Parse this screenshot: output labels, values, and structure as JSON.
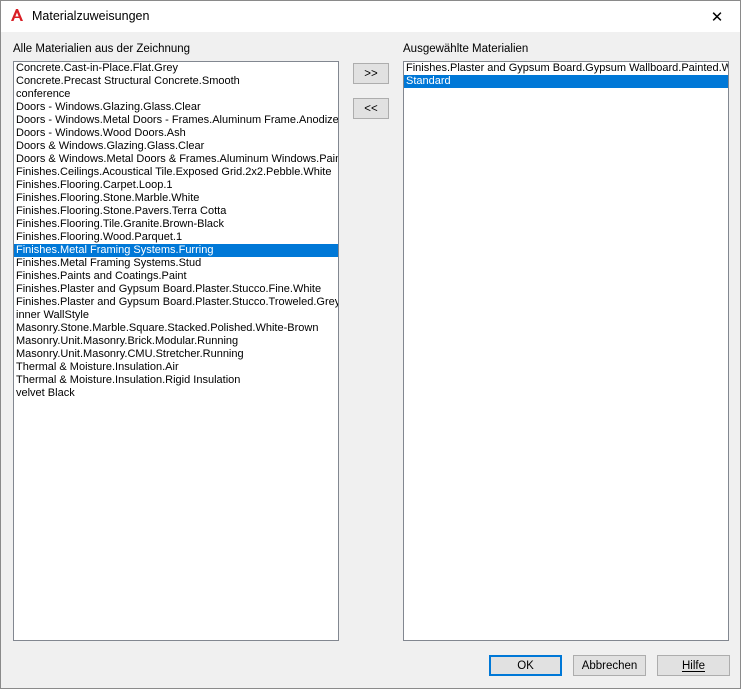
{
  "window": {
    "title": "Materialzuweisungen",
    "close_glyph": "✕"
  },
  "left_panel": {
    "label": "Alle Materialien aus der Zeichnung",
    "selected_index": 14,
    "items": [
      "Concrete.Cast-in-Place.Flat.Grey",
      "Concrete.Precast Structural Concrete.Smooth",
      "conference",
      "Doors - Windows.Glazing.Glass.Clear",
      "Doors - Windows.Metal Doors - Frames.Aluminum Frame.Anodized.",
      "Doors - Windows.Wood Doors.Ash",
      "Doors & Windows.Glazing.Glass.Clear",
      "Doors & Windows.Metal Doors & Frames.Aluminum Windows.Painte",
      "Finishes.Ceilings.Acoustical Tile.Exposed Grid.2x2.Pebble.White",
      "Finishes.Flooring.Carpet.Loop.1",
      "Finishes.Flooring.Stone.Marble.White",
      "Finishes.Flooring.Stone.Pavers.Terra Cotta",
      "Finishes.Flooring.Tile.Granite.Brown-Black",
      "Finishes.Flooring.Wood.Parquet.1",
      "Finishes.Metal Framing Systems.Furring",
      "Finishes.Metal Framing Systems.Stud",
      "Finishes.Paints and Coatings.Paint",
      "Finishes.Plaster and Gypsum Board.Plaster.Stucco.Fine.White",
      "Finishes.Plaster and Gypsum Board.Plaster.Stucco.Troweled.Grey",
      "inner WallStyle",
      "Masonry.Stone.Marble.Square.Stacked.Polished.White-Brown",
      "Masonry.Unit.Masonry.Brick.Modular.Running",
      "Masonry.Unit.Masonry.CMU.Stretcher.Running",
      "Thermal & Moisture.Insulation.Air",
      "Thermal & Moisture.Insulation.Rigid Insulation",
      "velvet Black"
    ]
  },
  "right_panel": {
    "label": "Ausgewählte Materialien",
    "selected_index": 1,
    "items": [
      "Finishes.Plaster and Gypsum Board.Gypsum Wallboard.Painted.Wh",
      "Standard"
    ]
  },
  "transfer": {
    "add_label": ">>",
    "remove_label": "<<"
  },
  "footer": {
    "ok_label": "OK",
    "cancel_label": "Abbrechen",
    "help_label": "Hilfe"
  },
  "colors": {
    "selection": "#0078d7",
    "app_icon": "#d91f26"
  }
}
